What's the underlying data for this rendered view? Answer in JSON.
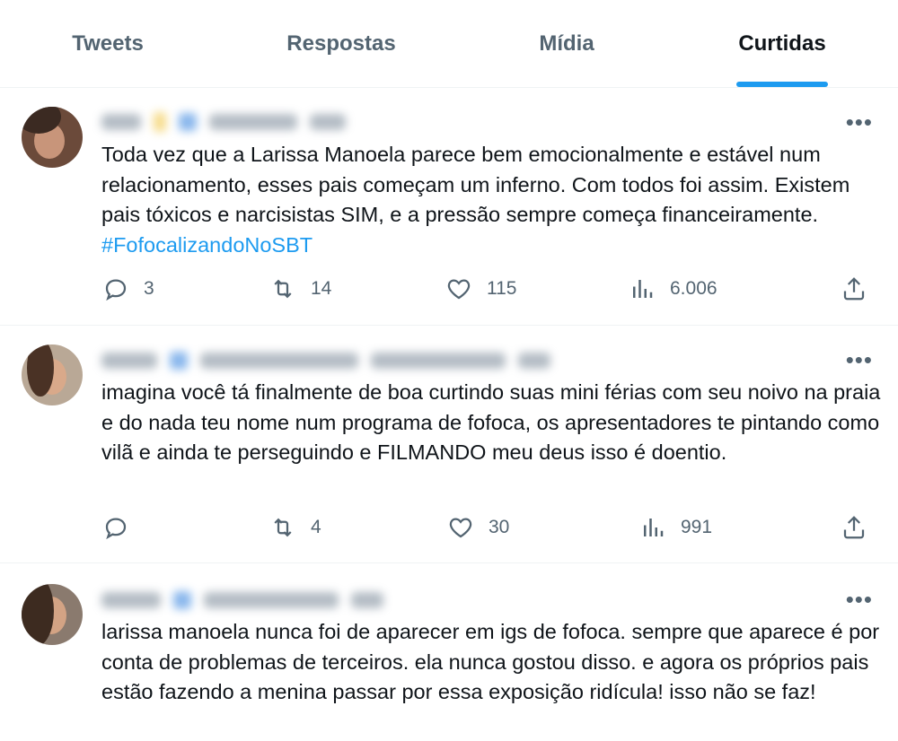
{
  "tabs": [
    {
      "label": "Tweets",
      "active": false
    },
    {
      "label": "Respostas",
      "active": false
    },
    {
      "label": "Mídia",
      "active": false
    },
    {
      "label": "Curtidas",
      "active": true
    }
  ],
  "tweets": [
    {
      "text": "Toda vez que a Larissa Manoela parece bem emocionalmente e estável num relacionamento, esses pais começam um inferno. Com todos foi assim. Existem pais tóxicos e narcisistas SIM, e a pressão sempre começa financeiramente. ",
      "hashtag": "#FofocalizandoNoSBT",
      "replies": "3",
      "retweets": "14",
      "likes": "115",
      "views": "6.006"
    },
    {
      "text": "imagina você tá finalmente de boa curtindo suas mini férias com seu noivo na praia e do nada teu nome num programa de fofoca, os apresentadores te pintando como vilã e ainda te perseguindo e FILMANDO meu deus isso é doentio.",
      "replies": "",
      "retweets": "4",
      "likes": "30",
      "views": "991"
    },
    {
      "text": "larissa manoela nunca foi de aparecer em igs de fofoca. sempre que aparece é por conta de problemas de terceiros. ela nunca gostou disso. e agora os próprios pais estão fazendo a menina passar por essa exposição ridícula! isso não se faz!"
    }
  ],
  "icons": {
    "more": "more-horizontal-icon",
    "reply": "reply-icon",
    "retweet": "retweet-icon",
    "like": "heart-icon",
    "views": "views-chart-icon",
    "share": "share-icon"
  },
  "colors": {
    "accent": "#1d9bf0",
    "text": "#0f1419",
    "muted": "#536471"
  }
}
